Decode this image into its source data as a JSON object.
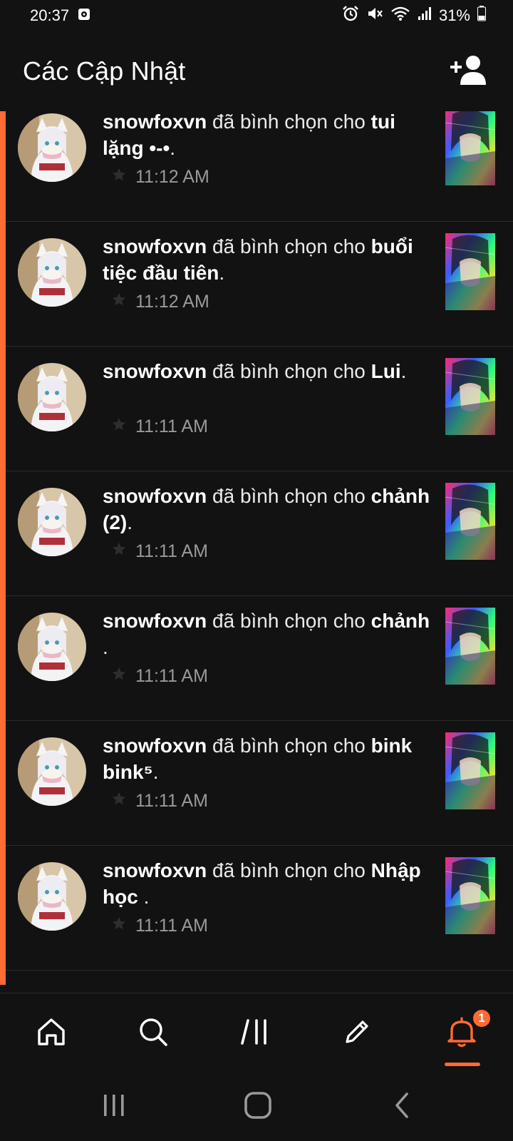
{
  "status_bar": {
    "time": "20:37",
    "battery": "31%"
  },
  "header": {
    "title": "Các Cập Nhật",
    "add_friend_icon": "add-user-icon"
  },
  "feed": {
    "accent_color": "#ff6b35",
    "items": [
      {
        "user": "snowfoxvn",
        "action": "đã bình chọn cho",
        "target": "tui lặng •-•",
        "time": "11:12 AM"
      },
      {
        "user": "snowfoxvn",
        "action": "đã bình chọn cho",
        "target": "buổi tiệc đầu tiên",
        "time": "11:12 AM"
      },
      {
        "user": "snowfoxvn",
        "action": "đã bình chọn cho",
        "target": "Lui",
        "time": "11:11 AM"
      },
      {
        "user": "snowfoxvn",
        "action": "đã bình chọn cho",
        "target": "chảnh (2)",
        "time": "11:11 AM"
      },
      {
        "user": "snowfoxvn",
        "action": "đã bình chọn cho",
        "target": "chảnh ",
        "time": "11:11 AM"
      },
      {
        "user": "snowfoxvn",
        "action": "đã bình chọn cho",
        "target": "bink bink⁵",
        "time": "11:11 AM"
      },
      {
        "user": "snowfoxvn",
        "action": "đã bình chọn cho",
        "target": "Nhập học ",
        "time": "11:11 AM"
      }
    ]
  },
  "bottom_nav": {
    "items": [
      {
        "name": "home",
        "icon": "home-icon"
      },
      {
        "name": "search",
        "icon": "search-icon"
      },
      {
        "name": "library",
        "icon": "library-icon"
      },
      {
        "name": "write",
        "icon": "pencil-icon"
      },
      {
        "name": "notifications",
        "icon": "bell-icon",
        "active": true
      }
    ],
    "notification_badge": "1"
  },
  "system_nav": {
    "items": [
      "recents-icon",
      "home-circle-icon",
      "back-icon"
    ]
  }
}
